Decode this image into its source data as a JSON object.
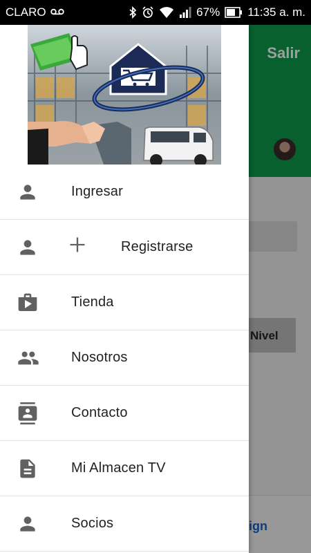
{
  "status_bar": {
    "carrier": "CLARO",
    "battery": "67%",
    "time": "11:35 a. m."
  },
  "background_app": {
    "header_color": "#0d9c4c",
    "logout_label": "Salir",
    "level_button": "Nivel",
    "footer_link": "ign"
  },
  "drawer": {
    "menu": [
      {
        "label": "Ingresar",
        "icon": "person-icon"
      },
      {
        "label": "Registrarse",
        "icon": "person-add-icon"
      },
      {
        "label": "Tienda",
        "icon": "shop-icon"
      },
      {
        "label": "Nosotros",
        "icon": "group-icon"
      },
      {
        "label": "Contacto",
        "icon": "contact-icon"
      },
      {
        "label": "Mi Almacen TV",
        "icon": "document-icon"
      },
      {
        "label": "Socios",
        "icon": "person-icon"
      }
    ]
  }
}
